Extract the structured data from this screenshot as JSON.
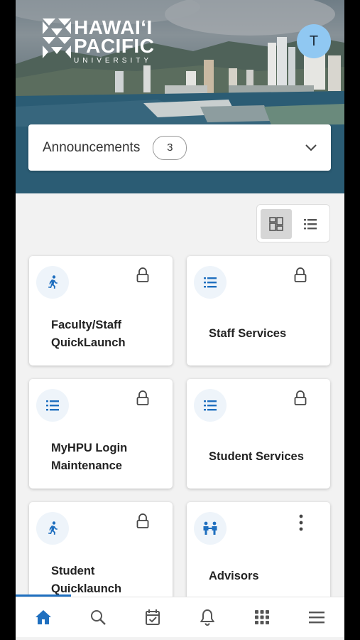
{
  "brand": {
    "line1": "HAWAIʻI",
    "line2": "PACIFIC",
    "line3": "UNIVERSITY"
  },
  "user": {
    "avatar_initial": "T"
  },
  "announcements": {
    "label": "Announcements",
    "count": "3"
  },
  "cards": [
    {
      "title_line1": "Faculty/Staff",
      "title_line2": "QuickLaunch",
      "icon": "running-person-icon",
      "badge": "lock-icon"
    },
    {
      "title_line1": "Staff Services",
      "title_line2": "",
      "icon": "list-icon",
      "badge": "lock-icon"
    },
    {
      "title_line1": "MyHPU Login",
      "title_line2": "Maintenance",
      "icon": "list-icon",
      "badge": "lock-icon"
    },
    {
      "title_line1": "Student Services",
      "title_line2": "",
      "icon": "list-icon",
      "badge": "lock-icon"
    },
    {
      "title_line1": "Student",
      "title_line2": "Quicklaunch",
      "icon": "running-person-icon",
      "badge": "lock-icon"
    },
    {
      "title_line1": "Advisors",
      "title_line2": "",
      "icon": "people-icon",
      "badge": "more-vertical-icon"
    }
  ],
  "nav": [
    "home-icon",
    "search-icon",
    "calendar-check-icon",
    "bell-icon",
    "apps-grid-icon",
    "menu-icon"
  ],
  "colors": {
    "accent": "#1f6fbf",
    "avatar": "#90c8f2"
  }
}
